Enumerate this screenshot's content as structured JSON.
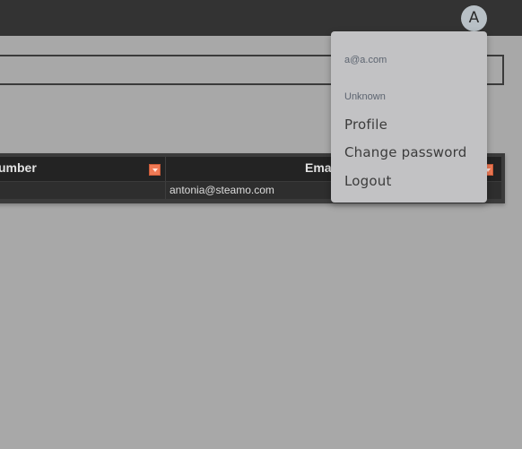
{
  "header": {
    "avatar_initial": "A"
  },
  "table": {
    "columns": [
      {
        "label": "umber"
      },
      {
        "label": "Ema"
      }
    ],
    "rows": [
      {
        "number": "",
        "email": "antonia@steamo.com"
      }
    ]
  },
  "user_menu": {
    "email": "a@a.com",
    "role": "Unknown",
    "items": [
      {
        "label": "Profile"
      },
      {
        "label": "Change password"
      },
      {
        "label": "Logout"
      }
    ]
  },
  "colors": {
    "background": "#a8a8a8",
    "topbar": "#333333",
    "filter_accent": "#f07a55",
    "menu_bg": "#c2c2c4"
  }
}
